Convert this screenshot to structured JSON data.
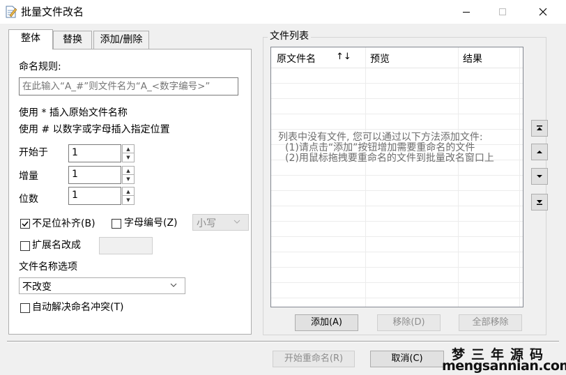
{
  "window": {
    "title": "批量文件改名",
    "minimize_glyph": "—",
    "maximize_glyph": "☐",
    "close_glyph": "✕"
  },
  "tabs": [
    {
      "label": "整体",
      "active": true
    },
    {
      "label": "替换",
      "active": false
    },
    {
      "label": "添加/删除",
      "active": false
    }
  ],
  "rule": {
    "label": "命名规则:",
    "placeholder": "在此输入“A_#”则文件名为“A_<数字编号>”",
    "hint_star": "使用 * 插入原始文件名称",
    "hint_hash": "使用 # 以数字或字母插入指定位置"
  },
  "fields": {
    "start": {
      "label": "开始于",
      "value": "1"
    },
    "step": {
      "label": "增量",
      "value": "1"
    },
    "digits": {
      "label": "位数",
      "value": "1"
    }
  },
  "options": {
    "pad": {
      "label": "不足位补齐(B)",
      "checked": true
    },
    "letter": {
      "label": "字母编号(Z)",
      "checked": false
    },
    "case_select": {
      "value": "小写",
      "disabled": true
    },
    "ext": {
      "label": "扩展名改成",
      "checked": false,
      "value": ""
    },
    "filename_options_label": "文件名称选项",
    "filename_select": {
      "value": "不改变"
    },
    "conflict": {
      "label": "自动解决命名冲突(T)",
      "checked": false
    }
  },
  "file_list": {
    "group_label": "文件列表",
    "columns": [
      "原文件名",
      "预览",
      "结果"
    ],
    "sort_arrows": "↑↓",
    "empty_message": [
      "列表中没有文件, 您可以通过以下方法添加文件:",
      "(1)请点击“添加”按钮增加需要重命名的文件",
      "(2)用鼠标拖拽要重命名的文件到批量改名窗口上"
    ]
  },
  "list_buttons": {
    "add": "添加(A)",
    "remove": "移除(D)",
    "remove_all": "全部移除"
  },
  "side_buttons": {
    "top": "⤒",
    "up": "▲",
    "down": "▼",
    "bottom": "⤓"
  },
  "footer": {
    "start": "开始重命名(R)",
    "cancel": "取消(C)"
  },
  "watermark": {
    "cn": "梦三年源码",
    "url": "mengsannian.com"
  },
  "icons": {
    "app": "rename-document-icon",
    "checkmark": "checkmark-icon",
    "dropdown": "chevron-down-icon"
  }
}
